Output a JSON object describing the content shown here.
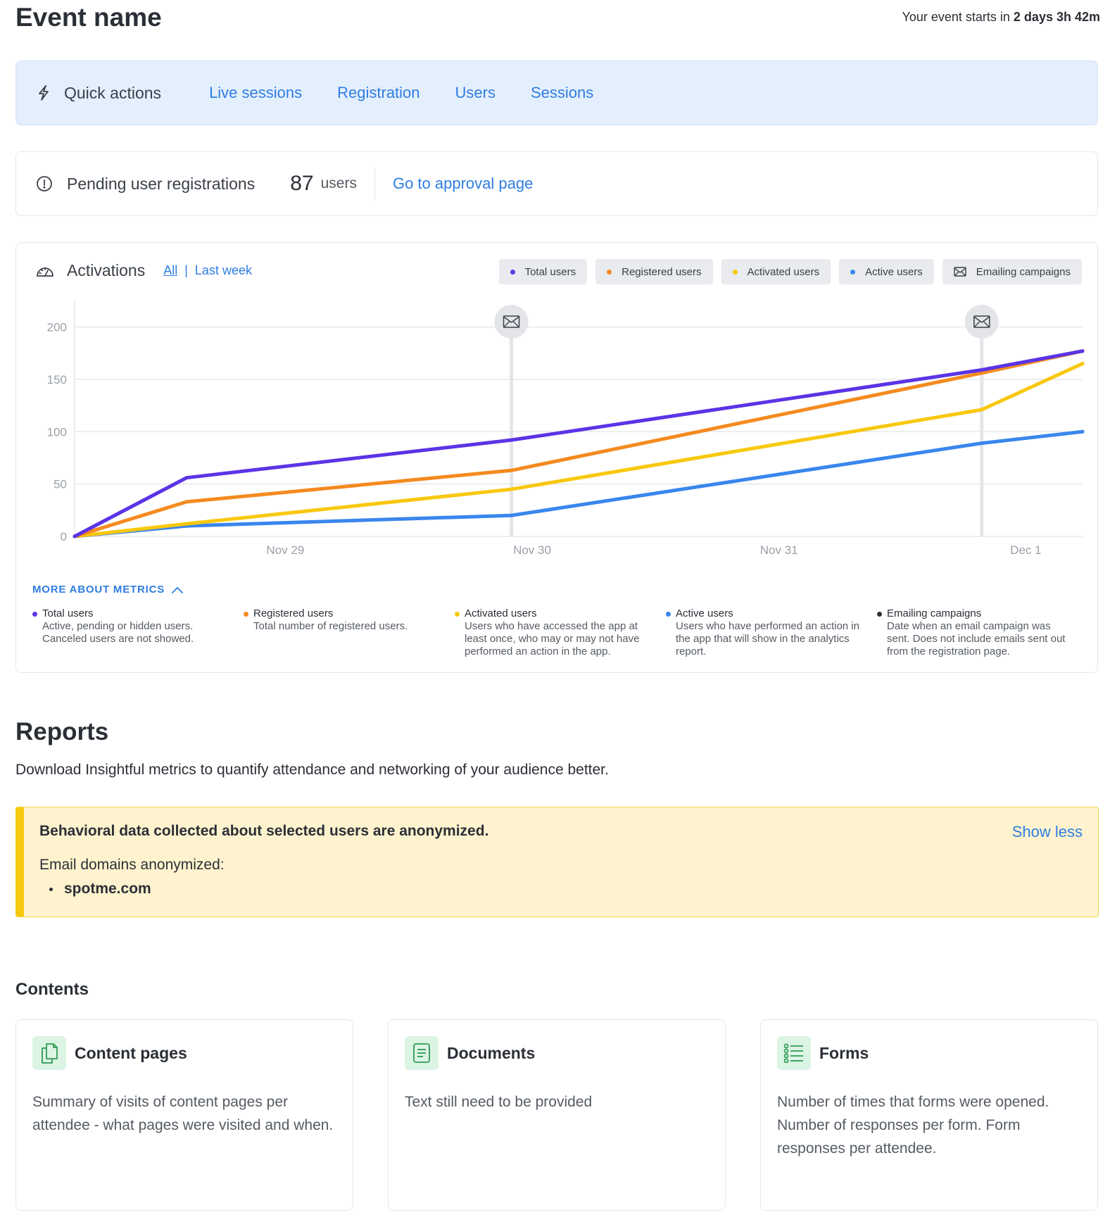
{
  "header": {
    "title": "Event name",
    "countdown_prefix": "Your event starts in ",
    "countdown_value": "2 days 3h 42m"
  },
  "quick_actions": {
    "title": "Quick actions",
    "links": [
      "Live sessions",
      "Registration",
      "Users",
      "Sessions"
    ]
  },
  "pending": {
    "title": "Pending user registrations",
    "count": "87",
    "unit": "users",
    "link": "Go to approval page"
  },
  "activations": {
    "title": "Activations",
    "range_all": "All",
    "range_separator": "|",
    "range_last_week": "Last week",
    "legend": [
      {
        "label": "Total users",
        "color": "#5b34e6"
      },
      {
        "label": "Registered users",
        "color": "#f58a1f"
      },
      {
        "label": "Activated users",
        "color": "#f9c80e"
      },
      {
        "label": "Active users",
        "color": "#3a86ee"
      },
      {
        "label": "Emailing campaigns",
        "color": "#2b2f36",
        "icon": "envelope-icon"
      }
    ],
    "more_metrics": "MORE ABOUT METRICS",
    "metrics": [
      {
        "name": "Total users",
        "desc": "Active, pending or hidden users. Canceled users are not showed.",
        "color": "#5b34e6"
      },
      {
        "name": "Registered users",
        "desc": "Total number of registered users.",
        "color": "#f58a1f"
      },
      {
        "name": "Activated users",
        "desc": "Users who have accessed the app at least once, who may or may not have performed an action in the app.",
        "color": "#f9c80e"
      },
      {
        "name": "Active users",
        "desc": "Users who have performed an action in the app that will show in the analytics report.",
        "color": "#3a86ee"
      },
      {
        "name": "Emailing campaigns",
        "desc": "Date when an email campaign was sent. Does not include emails sent out from the registration page.",
        "color": "#2b2f36"
      }
    ]
  },
  "chart_data": {
    "type": "line",
    "title": "Activations",
    "x_ticks": [
      "Nov 29",
      "Nov 30",
      "Nov 31",
      "Dec 1"
    ],
    "x": [
      0,
      0.5,
      1.95,
      4.05,
      4.5
    ],
    "ylim": [
      0,
      240
    ],
    "y_ticks": [
      0,
      50,
      100,
      150,
      200
    ],
    "grid": true,
    "series": [
      {
        "name": "Total users",
        "color": "#5b34e6",
        "values": [
          0,
          56,
          92,
          159,
          177
        ]
      },
      {
        "name": "Registered users",
        "color": "#f58a1f",
        "values": [
          0,
          33,
          63,
          156,
          177
        ]
      },
      {
        "name": "Activated users",
        "color": "#f9c80e",
        "values": [
          0,
          12,
          45,
          121,
          165
        ]
      },
      {
        "name": "Active users",
        "color": "#3a86ee",
        "values": [
          0,
          10,
          20,
          89,
          100
        ]
      }
    ],
    "email_campaigns_x": [
      1.95,
      4.05
    ]
  },
  "reports": {
    "title": "Reports",
    "description": "Download Insightful metrics to quantify attendance and networking of your audience better."
  },
  "notice": {
    "title": "Behavioral data collected about selected users are anonymized.",
    "toggle": "Show less",
    "subtitle": "Email domains anonymized:",
    "domains": [
      "spotme.com"
    ]
  },
  "contents": {
    "title": "Contents",
    "cards": [
      {
        "title": "Content pages",
        "icon": "pages-icon",
        "desc": "Summary of visits of content pages per attendee - what pages were visited and when."
      },
      {
        "title": "Documents",
        "icon": "document-icon",
        "desc": "Text still need to be provided"
      },
      {
        "title": "Forms",
        "icon": "form-list-icon",
        "desc": "Number of times that forms were opened. Number of responses per form. Form responses per attendee."
      }
    ]
  }
}
